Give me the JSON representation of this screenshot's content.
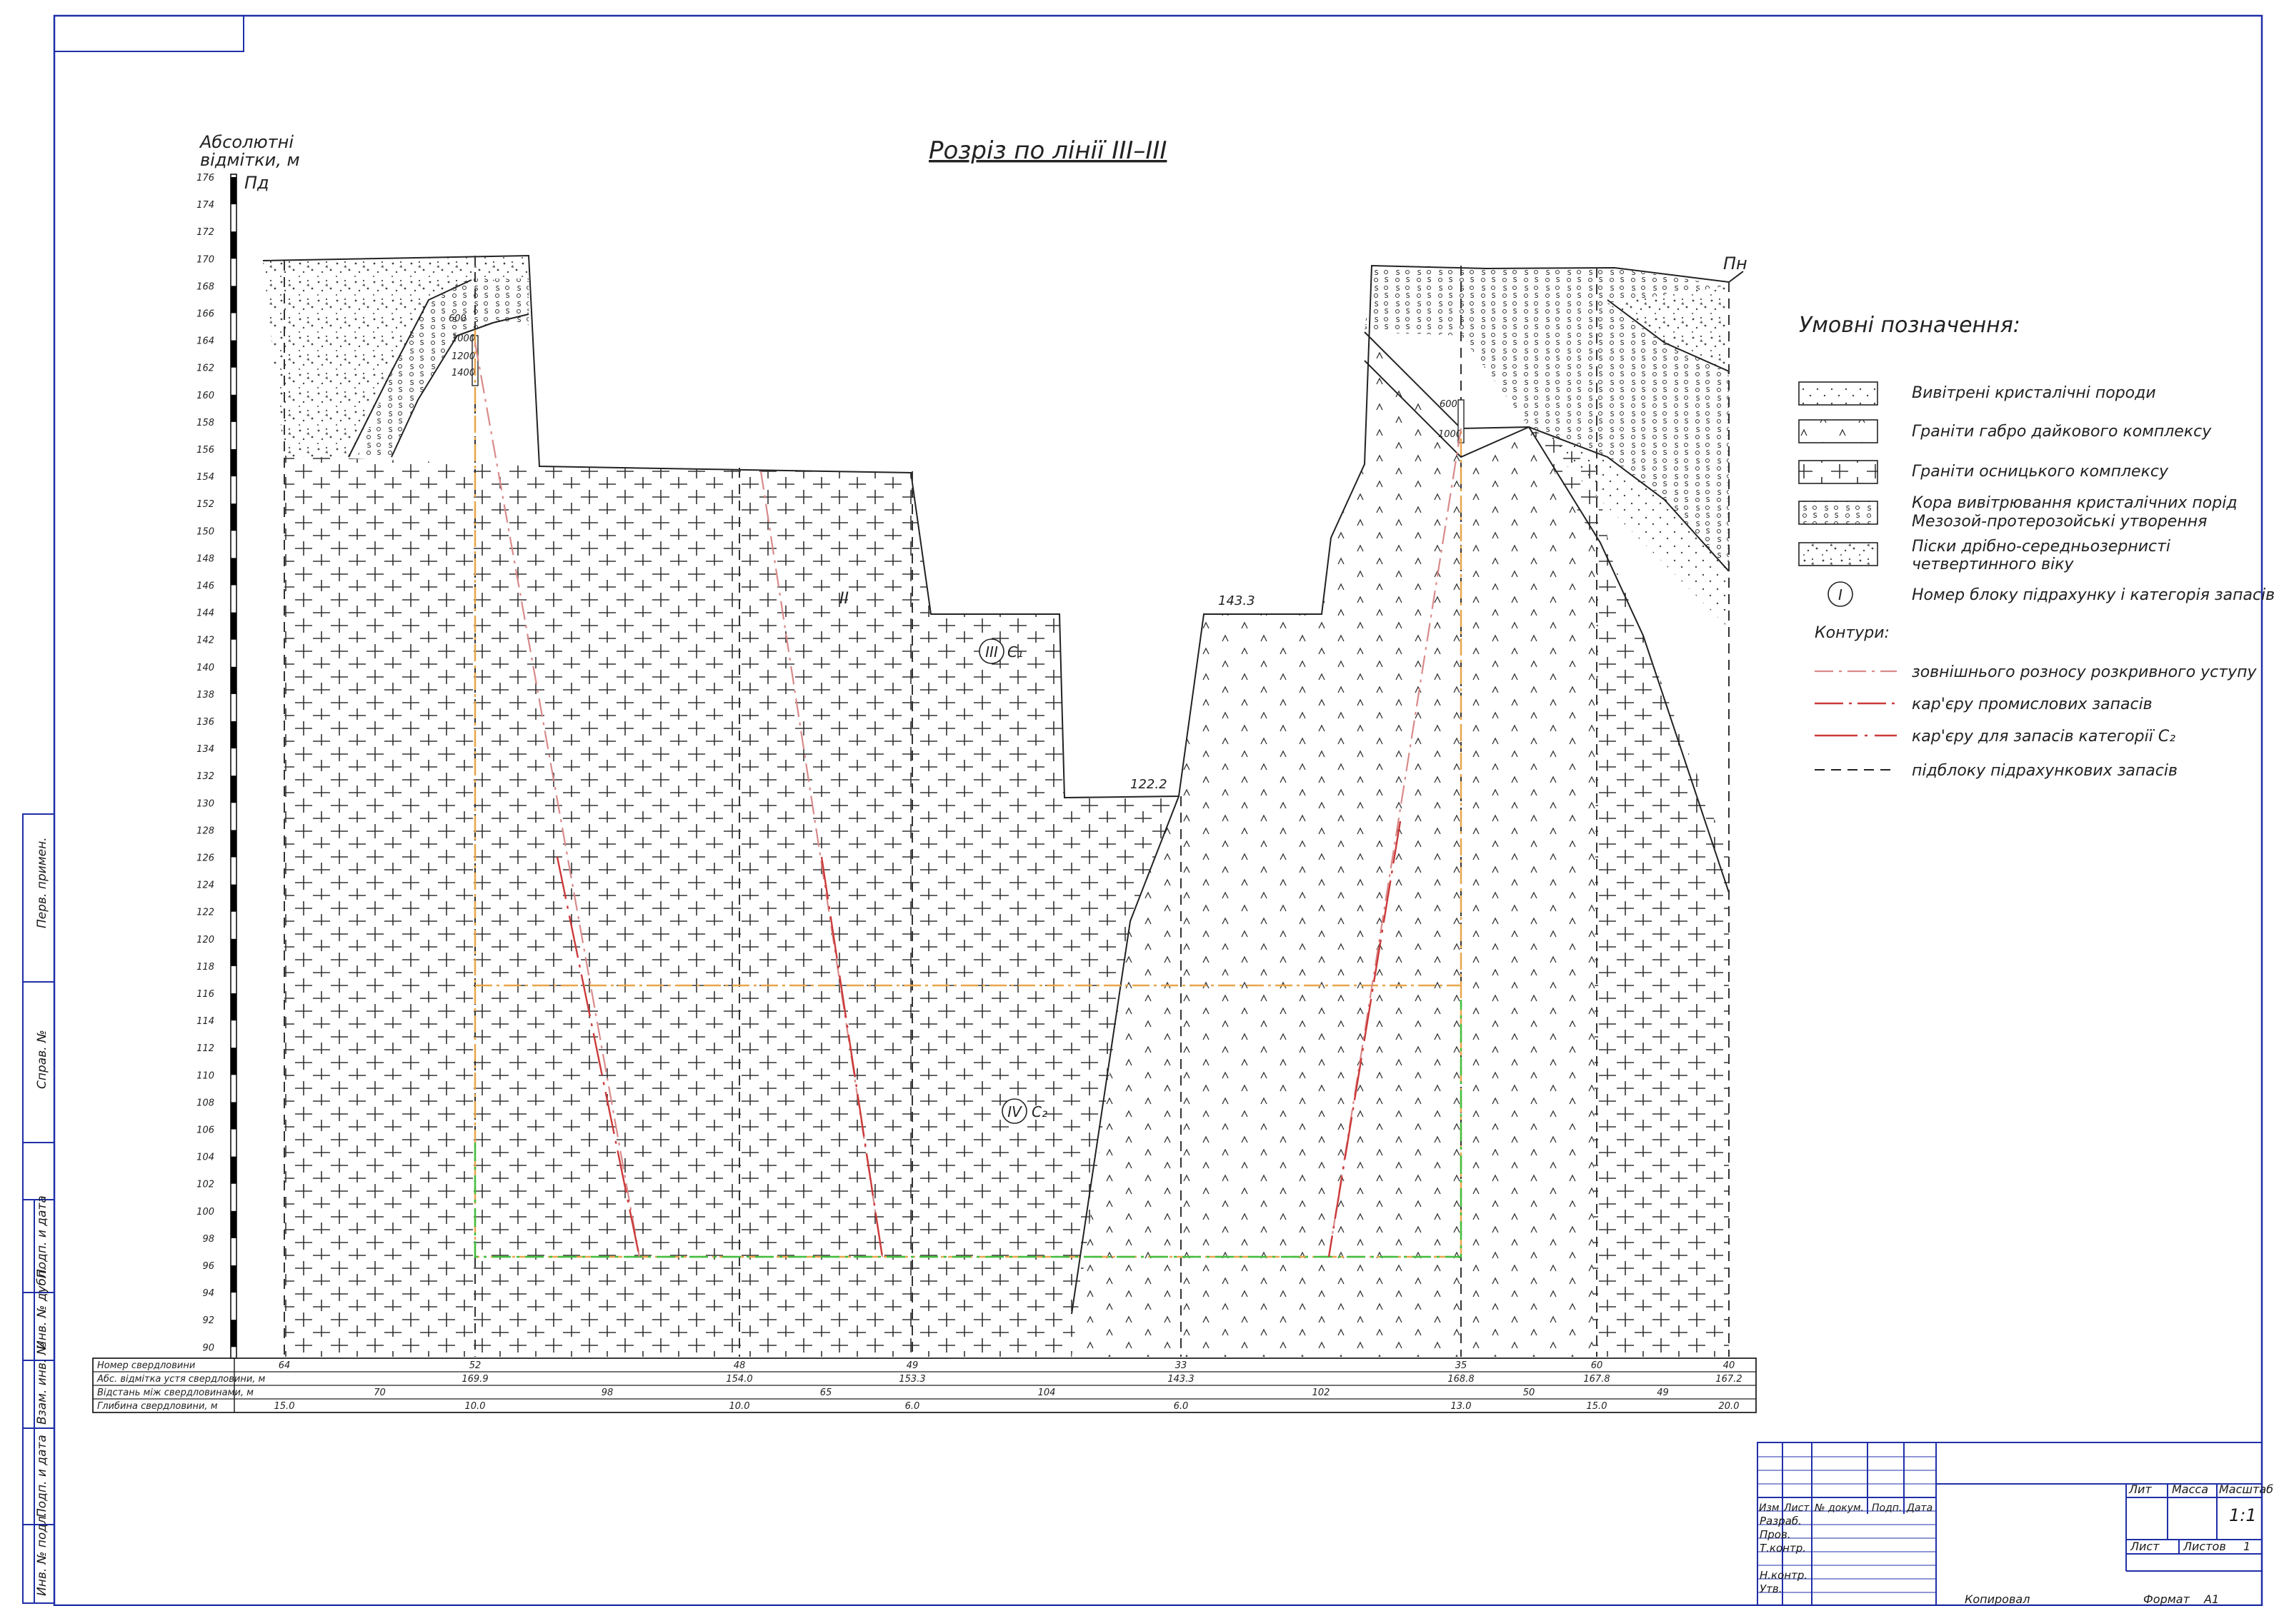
{
  "title": "Розріз по лінії ІІІ–ІІІ",
  "axis": {
    "label_line1": "Абсолютні",
    "label_line2": "відмітки, м",
    "ticks": [
      "176",
      "174",
      "172",
      "170",
      "168",
      "166",
      "164",
      "162",
      "160",
      "158",
      "156",
      "154",
      "152",
      "150",
      "148",
      "146",
      "144",
      "142",
      "140",
      "138",
      "136",
      "134",
      "132",
      "130",
      "128",
      "126",
      "124",
      "122",
      "120",
      "118",
      "116",
      "114",
      "112",
      "110",
      "108",
      "106",
      "104",
      "102",
      "100",
      "98",
      "96",
      "94",
      "92",
      "90"
    ]
  },
  "directions": {
    "left": "Пд",
    "right": "Пн"
  },
  "section_labels": {
    "elev_1": "143.3",
    "elev_2": "122.2",
    "block_3_num": "III",
    "block_3_cat": "C₁",
    "block_4_num": "IV",
    "block_4_cat": "C₂",
    "block_2_num": "II",
    "sample_depths_left": [
      "600",
      "1000",
      "1200",
      "1400"
    ],
    "sample_depths_right": [
      "600",
      "1000"
    ]
  },
  "legend": {
    "title": "Умовні позначення:",
    "items": [
      {
        "label": "Вивітрені кристалічні породи"
      },
      {
        "label": "Граніти габро дайкового комплексу"
      },
      {
        "label": "Граніти осницького комплексу"
      },
      {
        "label": "Кора вивітрювання кристалічних порід"
      },
      {
        "label": "Мезозой-протерозойські утворення"
      },
      {
        "label": "Піски дрібно-середньозернисті"
      },
      {
        "label": "четвертинного віку"
      },
      {
        "label": "Номер блоку підрахунку і категорія запасів"
      }
    ],
    "block_symbol": "I",
    "contours_title": "Контури:",
    "contours": [
      {
        "label": "зовнішнього розносу розкривного уступу",
        "color": "#d98a8a"
      },
      {
        "label": "кар'єру промислових запасів",
        "color": "#cc3a3a"
      },
      {
        "label": "кар'єру для запасів категорії C₂",
        "color": "#cc3a3a"
      },
      {
        "label": "підблоку підрахункових запасів",
        "color": "#222222"
      }
    ]
  },
  "table": {
    "row_labels": [
      "Номер свердловини",
      "Абс. відмітка устя свердловини, м",
      "Відстань між свердловинами, м",
      "Глибина свердловини, м"
    ],
    "wells": [
      "64",
      "52",
      "48",
      "49",
      "33",
      "35",
      "60",
      "40"
    ],
    "elevations": [
      "169.9",
      "154.0",
      "153.3",
      "143.3",
      "168.8",
      "167.8",
      "167.2"
    ],
    "distances": [
      "70",
      "98",
      "65",
      "104",
      "102",
      "50",
      "49"
    ],
    "depths": [
      "15.0",
      "10.0",
      "10.0",
      "6.0",
      "6.0",
      "13.0",
      "15.0",
      "20.0"
    ]
  },
  "stamp": {
    "lit": "Лит",
    "massa": "Масса",
    "masshtab": "Масштаб",
    "scale": "1:1",
    "list": "Лист",
    "listov": "Листов",
    "listov_val": "1",
    "rows": [
      "Изм",
      "Лист",
      "№ докум.",
      "Подп.",
      "Дата"
    ],
    "roles": [
      "Разраб.",
      "Пров.",
      "Т.контр.",
      "Н.контр.",
      "Утв."
    ],
    "kopiroval": "Копировал",
    "format": "Формат",
    "format_val": "А1"
  },
  "side_labels": [
    "Перв. примен.",
    "Справ. №",
    "Подп. и дата",
    "Инв. № дубл.",
    "Взам. инв. №",
    "Подп. и дата",
    "Инв. № подл."
  ]
}
